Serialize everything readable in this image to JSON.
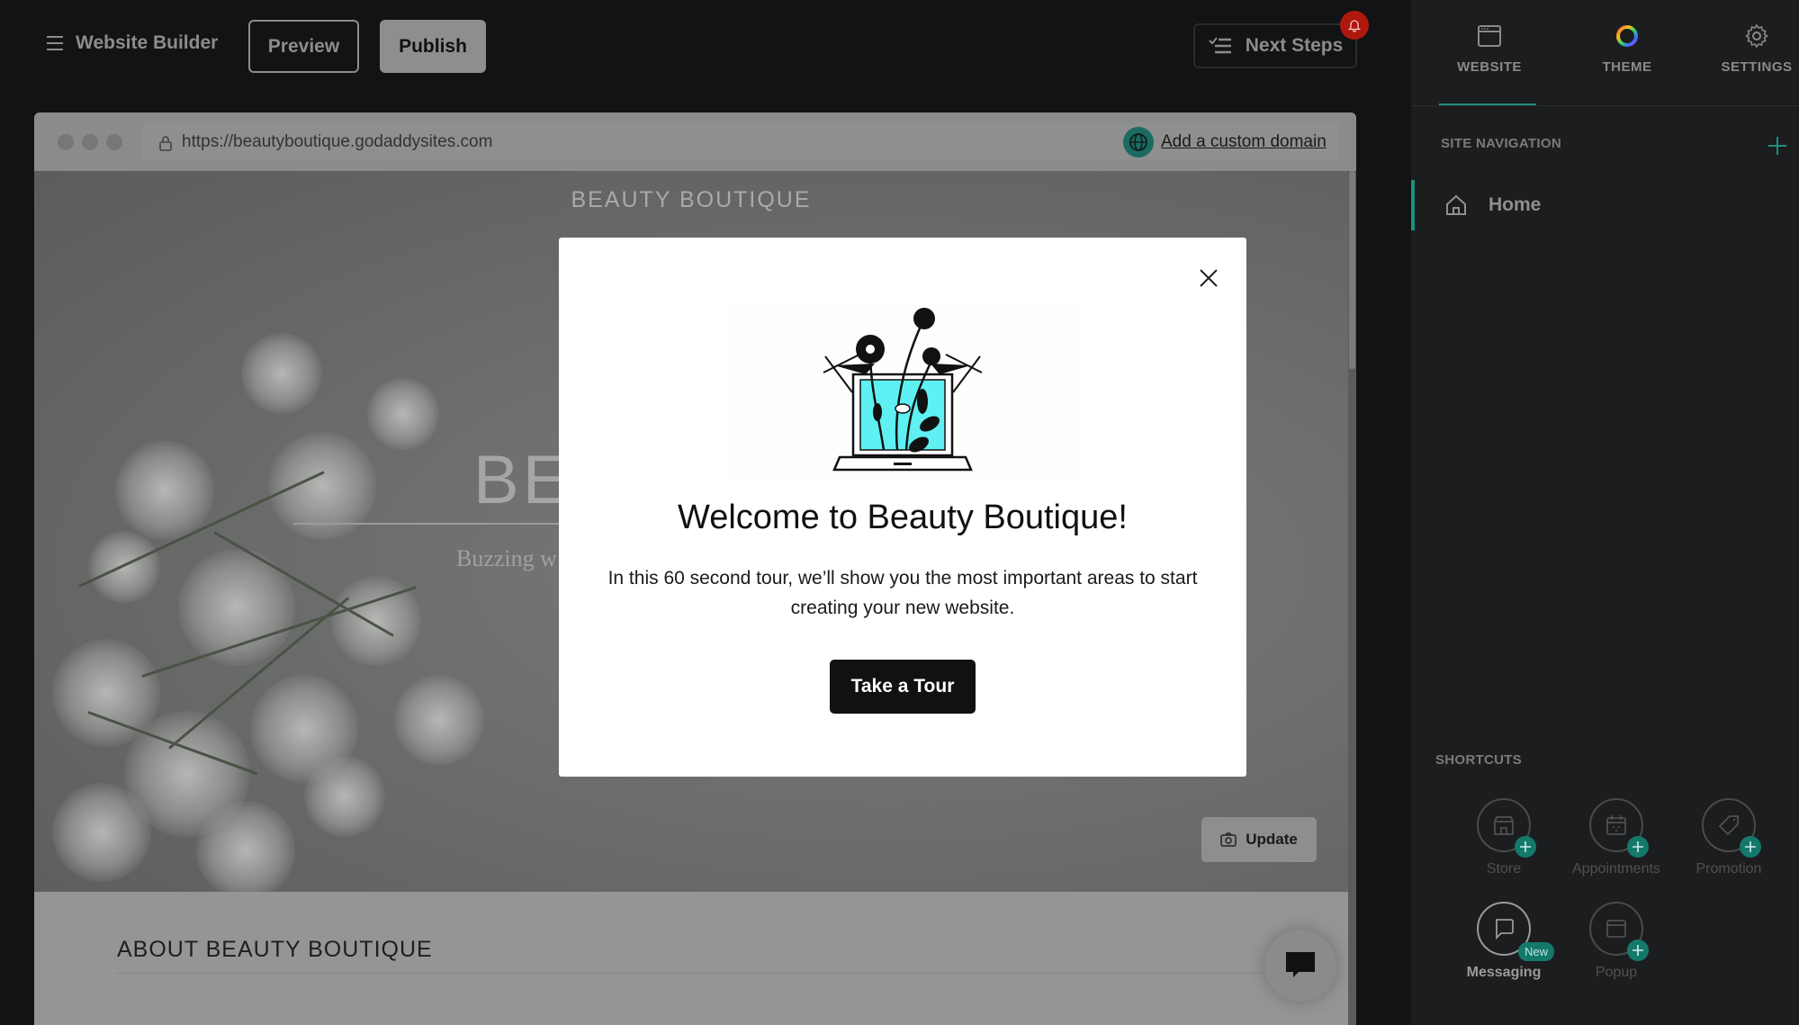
{
  "topbar": {
    "app_title": "Website Builder",
    "preview_label": "Preview",
    "publish_label": "Publish",
    "next_steps_label": "Next Steps",
    "notification_icon": "bell-icon"
  },
  "browser": {
    "url": "https://beautyboutique.godaddysites.com",
    "custom_domain_link": "Add a custom domain"
  },
  "site": {
    "brand": "BEAUTY BOUTIQUE",
    "hero_title_visible": "BEA",
    "hero_subtitle_visible": "Buzzing w",
    "update_button": "Update",
    "about_title": "ABOUT BEAUTY BOUTIQUE"
  },
  "modal": {
    "title": "Welcome to Beauty Boutique!",
    "body": "In this 60 second tour, we’ll show you the most important areas to start creating your new website.",
    "cta": "Take a Tour",
    "accent_color": "#5ef0f2"
  },
  "sidepanel": {
    "tabs": [
      {
        "label": "WEBSITE",
        "icon": "browser-window-icon",
        "active": true
      },
      {
        "label": "THEME",
        "icon": "color-ring-icon",
        "active": false
      },
      {
        "label": "SETTINGS",
        "icon": "gear-icon",
        "active": false
      }
    ],
    "site_navigation_label": "SITE NAVIGATION",
    "pages": [
      {
        "label": "Home",
        "icon": "home-icon",
        "active": true
      }
    ],
    "shortcuts_label": "SHORTCUTS",
    "shortcuts": [
      {
        "label": "Store",
        "icon": "store-icon",
        "badge": "plus"
      },
      {
        "label": "Appointments",
        "icon": "calendar-icon",
        "badge": "plus"
      },
      {
        "label": "Promotion",
        "icon": "tag-icon",
        "badge": "plus"
      },
      {
        "label": "Messaging",
        "icon": "chat-bubble-icon",
        "badge": "New"
      },
      {
        "label": "Popup",
        "icon": "popup-window-icon",
        "badge": "plus"
      }
    ],
    "accent_color": "#1f8f80"
  }
}
